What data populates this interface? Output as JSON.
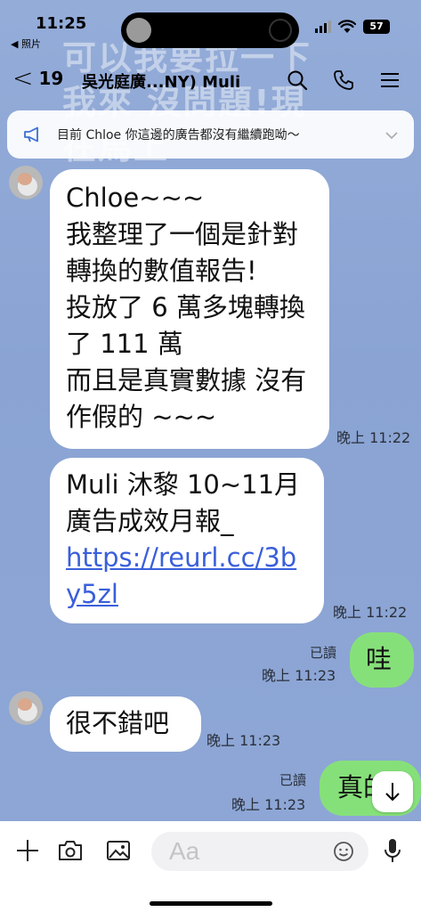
{
  "status_bar": {
    "time": "11:25",
    "back_app": "◀ 照片",
    "battery": "57"
  },
  "background_ghost_text": "可以我要拉一下 我來 沒問題!現在馬上",
  "header": {
    "back_icon": "chevron-left-icon",
    "unread_count": "19",
    "title": "吳光庭廣...NY) Muli",
    "icons": [
      "search-icon",
      "phone-icon",
      "menu-icon"
    ]
  },
  "announcement": {
    "icon": "megaphone-icon",
    "text": "目前 Chloe 你這邊的廣告都沒有繼續跑呦～"
  },
  "messages": [
    {
      "direction": "incoming",
      "text": "Chloe~~~\n我整理了一個是針對轉換的數值報告!\n投放了 6 萬多塊轉換了 111 萬\n而且是真實數據 沒有作假的 ~~~",
      "time": "晚上 11:22"
    },
    {
      "direction": "incoming",
      "text": "Muli 沐黎 10~11月廣告成效月報_",
      "link": "https://reurl.cc/3by5zl",
      "time": "晚上 11:22"
    },
    {
      "direction": "outgoing",
      "text": "哇",
      "read": "已讀",
      "time": "晚上 11:23"
    },
    {
      "direction": "incoming",
      "text": "很不錯吧",
      "time": "晚上 11:23"
    },
    {
      "direction": "outgoing",
      "text": "真的",
      "read": "已讀",
      "time": "晚上 11:23"
    }
  ],
  "input_bar": {
    "placeholder": "Aa",
    "icons": [
      "plus-icon",
      "camera-icon",
      "image-icon",
      "emoji-icon",
      "microphone-icon"
    ]
  },
  "colors": {
    "chat_background": "#8fa8d6",
    "outgoing_bubble": "#86e07a",
    "incoming_bubble": "#ffffff",
    "link": "#3a5fdb"
  }
}
